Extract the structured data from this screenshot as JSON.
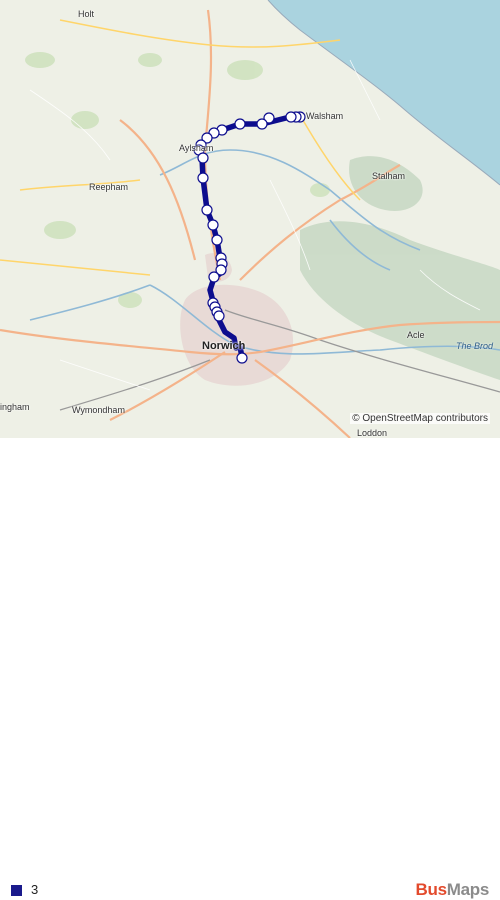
{
  "map": {
    "places": {
      "holt": "Holt",
      "aylsham": "Aylsham",
      "north_walsham": "Walsham",
      "reepham": "Reepham",
      "stalham": "Stalham",
      "norwich": "Norwich",
      "acle": "Acle",
      "wymondham": "Wymondham",
      "dereham": "ingham",
      "loddon": "Loddon"
    },
    "water": {
      "the_broads": "The Brod"
    },
    "attribution": "© OpenStreetMap contributors",
    "colors": {
      "route": "#0d0d8e",
      "sea": "#aad3df",
      "land": "#eef0e6",
      "urban": "#e6d6d2"
    }
  },
  "legend": {
    "route_name": "3",
    "swatch_color": "#1a1a8c"
  },
  "brand": {
    "part1": "Bus",
    "part2": "Maps"
  }
}
